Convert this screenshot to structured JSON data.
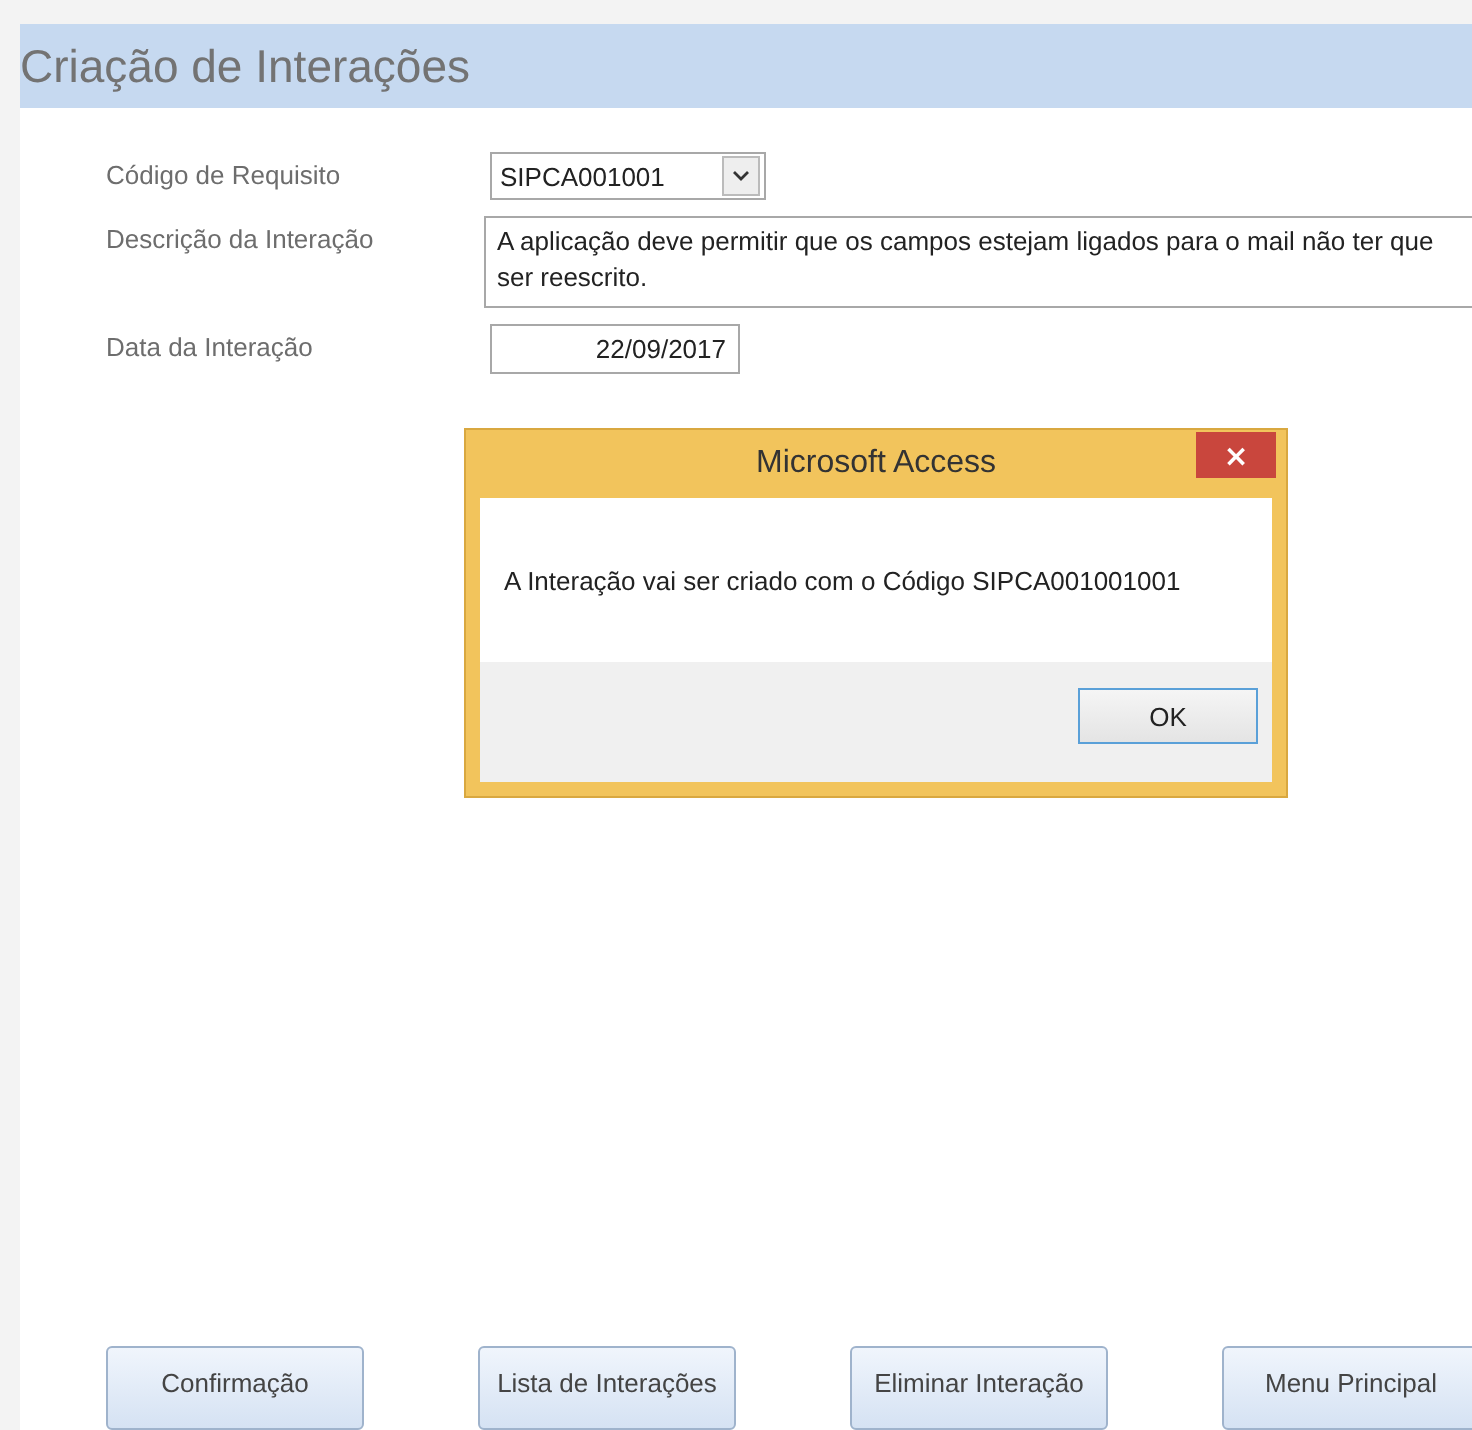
{
  "form_title": "Criação de Interações",
  "fields": [
    {
      "label": "Código de Requisito",
      "value": "SIPCA001001",
      "kind": "combo"
    },
    {
      "label": "Descrição da Interação",
      "value": "A aplicação deve permitir que os campos estejam ligados para o mail não ter que ser reescrito.",
      "kind": "memo"
    },
    {
      "label": "Data da Interação",
      "value": "22/09/2017",
      "kind": "date"
    }
  ],
  "dialog": {
    "title": "Microsoft Access",
    "close": "×",
    "message": "A Interação vai ser criado com o Código SIPCA001001001",
    "button": "OK"
  },
  "buttons": [
    "Confirmação",
    "Lista de Interações",
    "Eliminar Interação",
    "Menu Principal"
  ]
}
